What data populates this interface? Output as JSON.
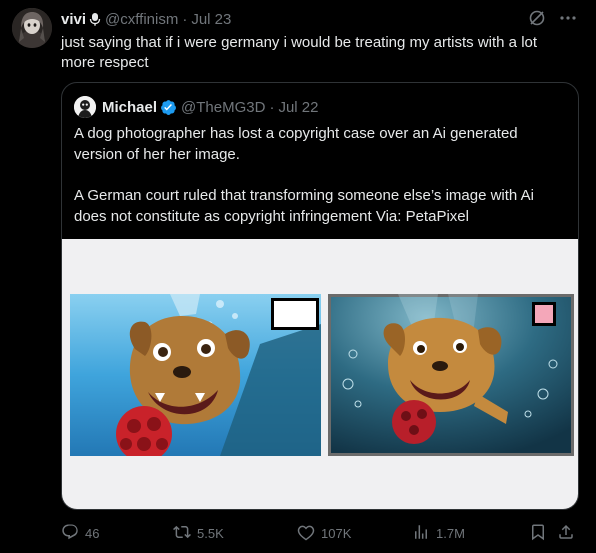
{
  "author": {
    "display_name": "vivi",
    "name_emoji": "microphone",
    "handle": "@cxffinism",
    "separator": "·",
    "time": "Jul 23"
  },
  "header_icons": [
    "grok-icon",
    "more-icon"
  ],
  "tweet_text": "just saying that if i were germany i would be treating my artists with a lot more respect",
  "quote": {
    "display_name": "Michael",
    "verified": true,
    "handle": "@TheMG3D",
    "separator": "·",
    "time": "Jul 22",
    "paragraph_1": "A dog photographer has lost a copyright case over an Ai generated version of her her image.",
    "paragraph_2": "A German court ruled that transforming someone else’s image with Ai does not constitute as copyright infringement Via: PetaPixel",
    "media": {
      "left_image": "original dog photo underwater with red ball",
      "right_image": "ai generated dog painting underwater with red ball",
      "left_swatch_color": "#ffffff",
      "right_swatch_color": "#f4a7b9"
    }
  },
  "actions": {
    "replies": "46",
    "reposts": "5.5K",
    "likes": "107K",
    "views": "1.7M"
  },
  "colors": {
    "background": "#000000",
    "text": "#e7e9ea",
    "muted": "#71767b",
    "border": "#2f3336",
    "verified": "#1d9bf0"
  }
}
